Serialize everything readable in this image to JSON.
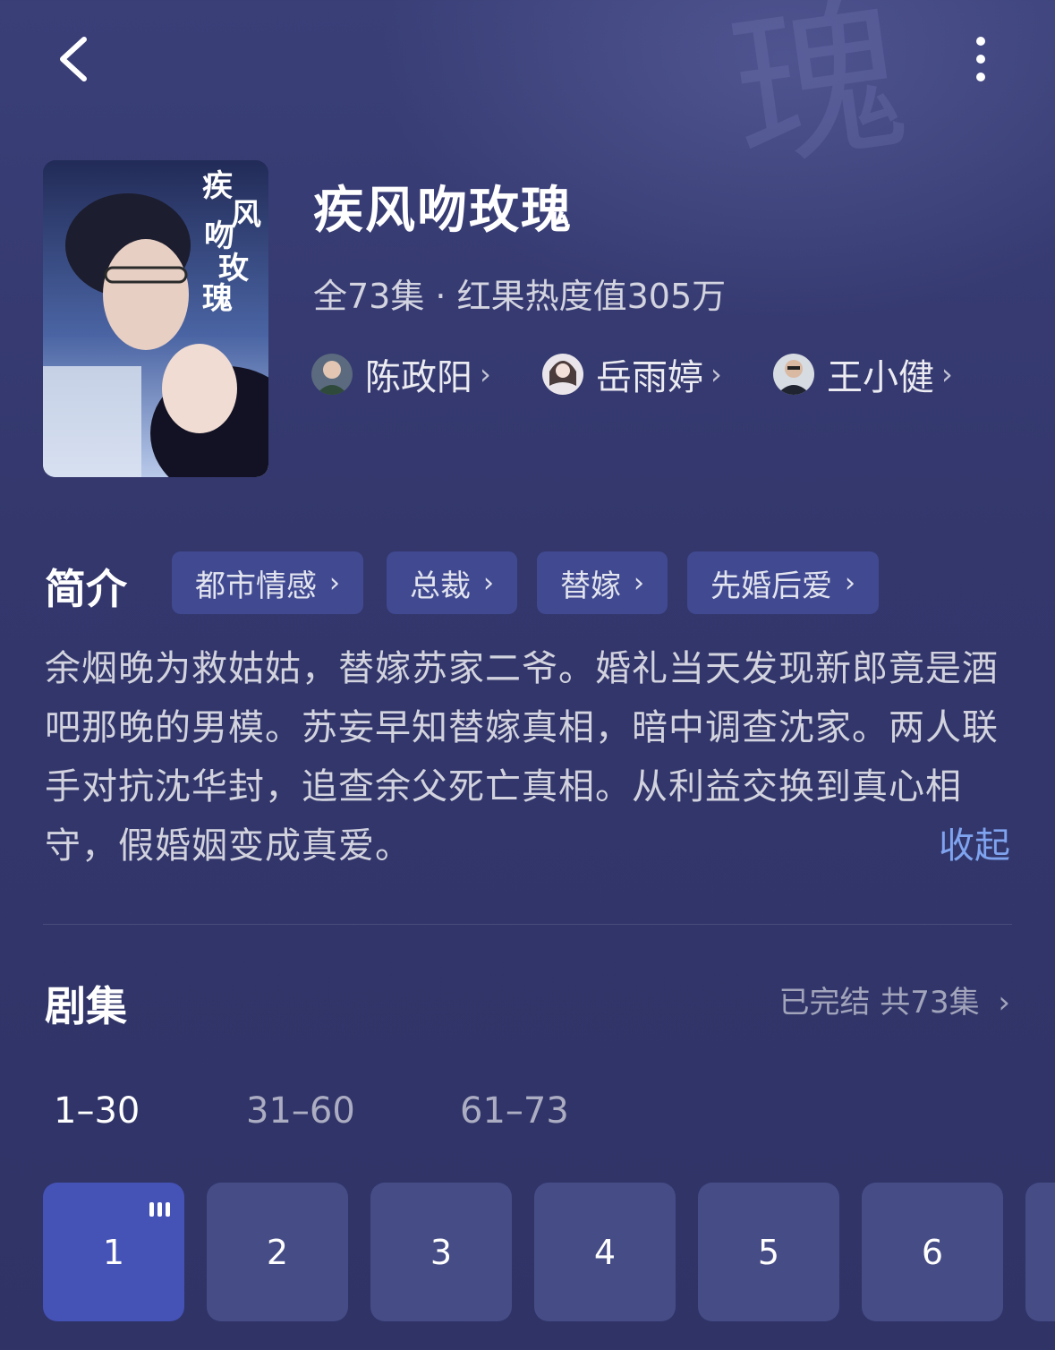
{
  "header": {
    "back_icon": "chevron-left-icon",
    "more_icon": "vertical-dots-icon"
  },
  "show": {
    "title": "疾风吻玫瑰",
    "meta": "全73集 · 红果热度值305万",
    "cast": [
      {
        "name": "陈政阳"
      },
      {
        "name": "岳雨婷"
      },
      {
        "name": "王小健"
      }
    ]
  },
  "intro": {
    "label": "简介",
    "tags": [
      "都市情感",
      "总裁",
      "替嫁",
      "先婚后爱"
    ],
    "description": "余烟晚为救姑姑，替嫁苏家二爷。婚礼当天发现新郎竟是酒吧那晚的男模。苏妄早知替嫁真相，暗中调查沈家。两人联手对抗沈华封，追查余父死亡真相。从利益交换到真心相守，假婚姻变成真爱。",
    "collapse": "收起"
  },
  "episodes": {
    "label": "剧集",
    "status": "已完结 共73集",
    "ranges": [
      "1–30",
      "31–60",
      "61–73"
    ],
    "active_range": 0,
    "items": [
      "1",
      "2",
      "3",
      "4",
      "5",
      "6"
    ],
    "playing": 0
  },
  "colors": {
    "accent": "#7fa3ee",
    "tag_bg": "#414a91",
    "ep_active": "#4552b6",
    "ep_bg": "#464c86"
  }
}
